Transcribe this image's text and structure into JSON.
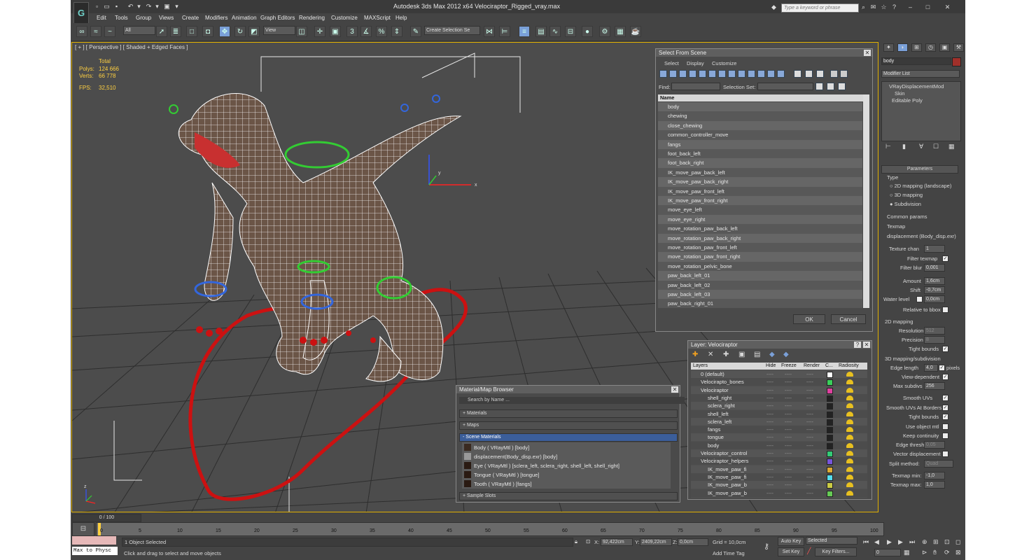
{
  "title": "Autodesk 3ds Max  2012 x64      Velociraptor_Rigged_vray.max",
  "search_placeholder": "Type a keyword or phrase",
  "menus": [
    "Edit",
    "Tools",
    "Group",
    "Views",
    "Create",
    "Modifiers",
    "Animation",
    "Graph Editors",
    "Rendering",
    "Customize",
    "MAXScript",
    "Help"
  ],
  "toolbar": {
    "filter": "All",
    "ref_coord": "View",
    "selection_set": "Create Selection Se"
  },
  "viewport": {
    "label": "[ + ] [ Perspective ] [ Shaded + Edged Faces ]",
    "stats_total": "Total",
    "polys_label": "Polys:",
    "polys_value": "124 666",
    "verts_label": "Verts:",
    "verts_value": "66 778",
    "fps_label": "FPS:",
    "fps_value": "32,510",
    "gizmo_y": "y",
    "gizmo_x": "x",
    "gizmo_z": "z"
  },
  "select_dialog": {
    "title": "Select From Scene",
    "menus": [
      "Select",
      "Display",
      "Customize"
    ],
    "find_label": "Find:",
    "selset_label": "Selection Set:",
    "column": "Name",
    "items": [
      "body",
      "chewing",
      "close_chewing",
      "common_controller_move",
      "fangs",
      "foot_back_left",
      "foot_back_right",
      "IK_move_paw_back_left",
      "IK_move_paw_back_right",
      "IK_move_paw_front_left",
      "IK_move_paw_front_right",
      "move_eye_left",
      "move_eye_right",
      "move_rotation_paw_back_left",
      "move_rotation_paw_back_right",
      "move_rotation_paw_front_left",
      "move_rotation_paw_front_right",
      "move_rotation_pelvic_bone",
      "paw_back_left_01",
      "paw_back_left_02",
      "paw_back_left_03",
      "paw_back_right_01"
    ],
    "ok": "OK",
    "cancel": "Cancel"
  },
  "layer_dialog": {
    "title": "Layer: Velociraptor",
    "columns": [
      "Layers",
      "Hide",
      "Freeze",
      "Render",
      "C...",
      "Radiosity"
    ],
    "items": [
      "0 (default)",
      "Velocirapto_bones",
      "Velociraptor",
      "shell_right",
      "sclera_right",
      "shell_left",
      "sclera_left",
      "fangs",
      "tongue",
      "body",
      "Velociraptor_control",
      "Velociraptor_helpers",
      "IK_move_paw_fi",
      "IK_move_paw_fi",
      "IK_move_paw_b",
      "IK_move_paw_b"
    ],
    "dash": "----"
  },
  "material_browser": {
    "title": "Material/Map Browser",
    "search": "Search by Name ...",
    "groups": [
      "+ Materials",
      "+ Maps",
      "- Scene Materials",
      "+ Sample Slots"
    ],
    "items": [
      "Body  ( VRayMtl ) [body]",
      "displacement(Body_disp.exr) [body]",
      "Eye  ( VRayMtl ) [sclera_left, sclera_right, shell_left, shell_right]",
      "Tongue  ( VRayMtl ) [tongue]",
      "Tooth  ( VRayMtl ) [fangs]"
    ]
  },
  "command_panel": {
    "object_name": "body",
    "modifier_list": "Modifier List",
    "stack": [
      "VRayDisplacementMod",
      "Skin",
      "Editable Poly"
    ],
    "rollout": "Parameters",
    "type_label": "Type",
    "types": [
      "2D mapping (landscape)",
      "3D mapping",
      "Subdivision"
    ],
    "common_params": "Common params",
    "texmap_label": "Texmap",
    "texmap_value": "displacement (Body_disp.exr)",
    "texture_chan_label": "Texture chan",
    "texture_chan_value": "1",
    "filter_texmap": "Filter texmap",
    "filter_blur_label": "Filter blur",
    "filter_blur_value": "0,001",
    "amount_label": "Amount",
    "amount_value": "1,6cm",
    "shift_label": "Shift",
    "shift_value": "-0,7cm",
    "water_level_label": "Water level",
    "water_level_value": "0,0cm",
    "relative_bbox": "Relative to bbox",
    "mapping2d": "2D mapping",
    "resolution_label": "Resolution",
    "resolution_value": "512",
    "precision_label": "Precision",
    "precision_value": "8",
    "tight_bounds": "Tight bounds",
    "mapping3d": "3D mapping/subdivision",
    "edge_length_label": "Edge length",
    "edge_length_value": "4,0",
    "pixels": "pixels",
    "view_dependent": "View-dependent",
    "max_subdivs_label": "Max subdivs",
    "max_subdivs_value": "256",
    "smooth_uvs": "Smooth UVs",
    "smooth_uvs_borders": "Smooth UVs At Borders",
    "tight_bounds2": "Tight bounds",
    "use_object_mtl": "Use object mtl",
    "keep_continuity": "Keep continuity",
    "edge_thresh_label": "Edge thresh",
    "edge_thresh_value": "0,05",
    "vector_displacement": "Vector displacement",
    "split_method_label": "Split method:",
    "split_method_value": "Quad",
    "texmap_min_label": "Texmap min:",
    "texmap_min_value": "-1,0",
    "texmap_max_label": "Texmap max:",
    "texmap_max_value": "1,0"
  },
  "timeline": {
    "frame": "0 / 100",
    "ticks": [
      "0",
      "5",
      "10",
      "15",
      "20",
      "25",
      "30",
      "35",
      "40",
      "45",
      "50",
      "55",
      "60",
      "65",
      "70",
      "75",
      "80",
      "85",
      "90",
      "95",
      "100"
    ]
  },
  "status": {
    "script_listener": "Max to Physc",
    "selected": "1 Object Selected",
    "prompt": "Click and drag to select and move objects",
    "x_label": "X:",
    "x_value": "92,422cm",
    "y_label": "Y:",
    "y_value": "2409,22cm",
    "z_label": "Z:",
    "z_value": "0,0cm",
    "grid": "Grid = 10,0cm",
    "add_time_tag": "Add Time Tag",
    "auto_key": "Auto Key",
    "set_key": "Set Key",
    "selected_dropdown": "Selected",
    "key_filters": "Key Filters...",
    "current_frame": "0"
  }
}
